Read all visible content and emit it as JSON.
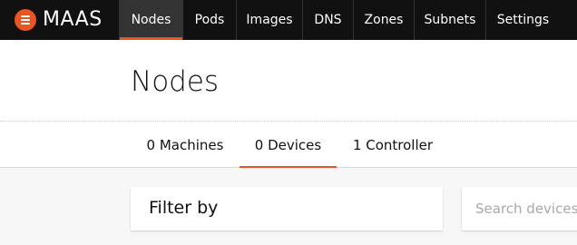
{
  "brand": {
    "name": "MAAS",
    "logo_icon": "maas-menu-icon",
    "accent_color": "#e95420"
  },
  "nav": {
    "items": [
      {
        "label": "Nodes",
        "active": true
      },
      {
        "label": "Pods",
        "active": false
      },
      {
        "label": "Images",
        "active": false
      },
      {
        "label": "DNS",
        "active": false
      },
      {
        "label": "Zones",
        "active": false
      },
      {
        "label": "Subnets",
        "active": false
      },
      {
        "label": "Settings",
        "active": false
      }
    ]
  },
  "page": {
    "title": "Nodes"
  },
  "tabs": [
    {
      "label": "0 Machines",
      "active": false
    },
    {
      "label": "0 Devices",
      "active": true
    },
    {
      "label": "1 Controller",
      "active": false
    }
  ],
  "filter": {
    "label": "Filter by"
  },
  "search": {
    "placeholder": "Search devices"
  }
}
